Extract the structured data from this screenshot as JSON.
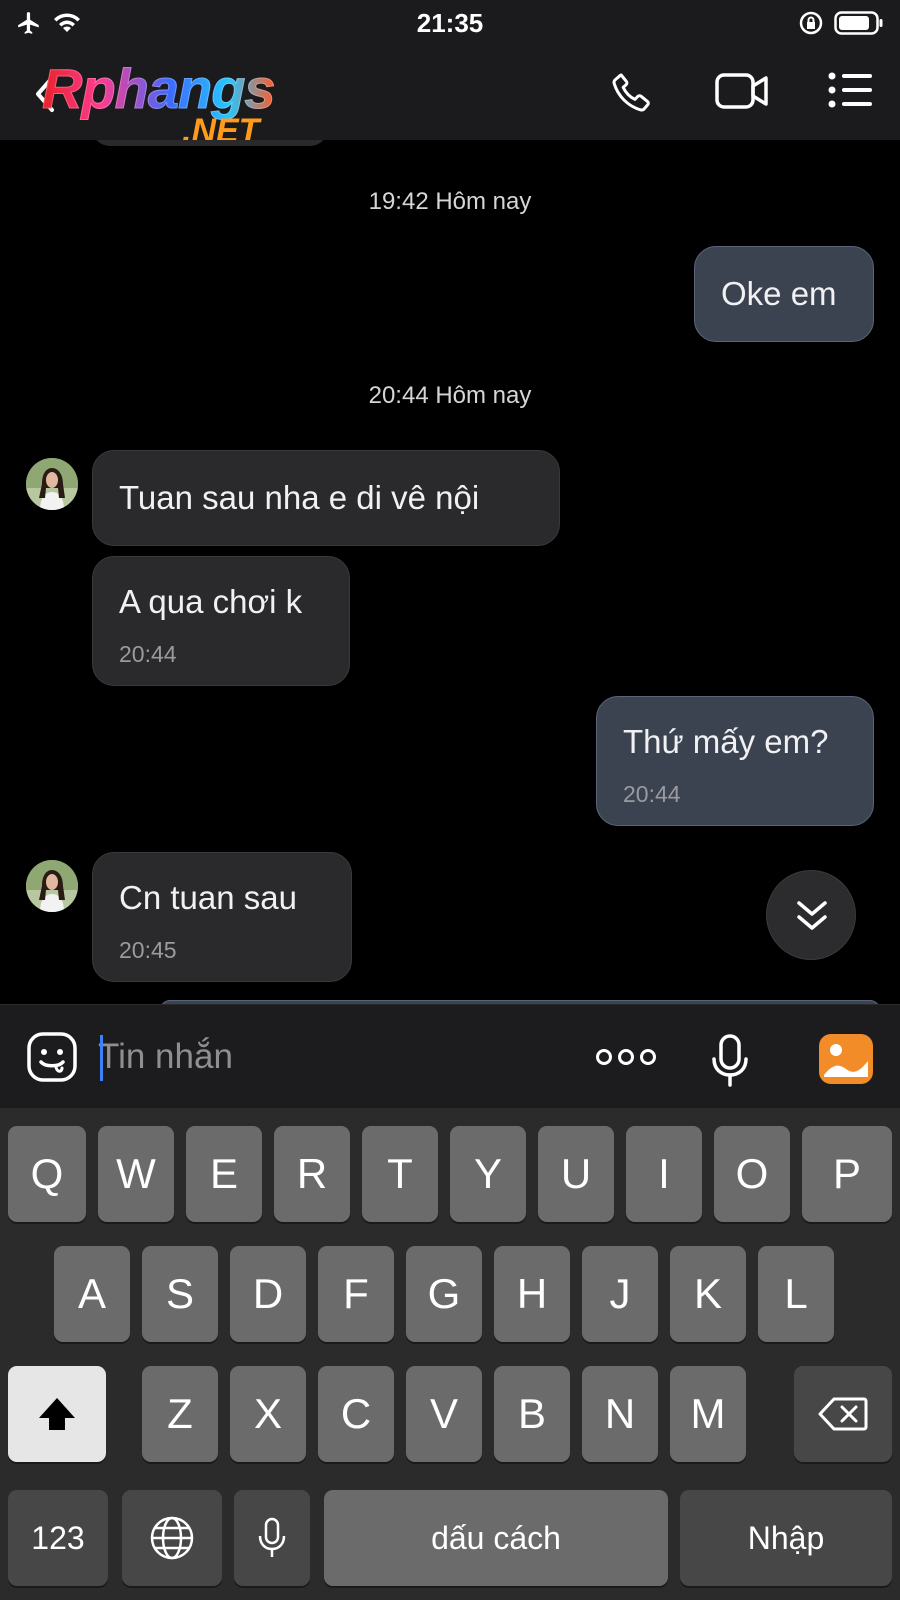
{
  "status_bar": {
    "time": "21:35"
  },
  "header": {
    "logo_text": "Rphangs",
    "logo_suffix": ".NET",
    "icons": [
      "back-icon",
      "phone-icon",
      "video-call-icon",
      "menu-list-icon"
    ]
  },
  "chat": {
    "timestamps": [
      "19:42 Hôm nay",
      "20:44 Hôm nay"
    ],
    "messages": [
      {
        "direction": "outgoing",
        "text": "Oke em",
        "time": ""
      },
      {
        "direction": "incoming",
        "text": " Tuan sau nha e di vê  nội",
        "time": ""
      },
      {
        "direction": "incoming",
        "text": "A qua chơi k",
        "time": "20:44"
      },
      {
        "direction": "outgoing",
        "text": "Thứ mấy em?",
        "time": "20:44"
      },
      {
        "direction": "incoming",
        "text": " Cn tuan sau",
        "time": "20:45"
      }
    ]
  },
  "input_bar": {
    "placeholder": "Tin nhắn",
    "value": ""
  },
  "keyboard": {
    "row1": [
      "Q",
      "W",
      "E",
      "R",
      "T",
      "Y",
      "U",
      "I",
      "O",
      "P"
    ],
    "row2": [
      "A",
      "S",
      "D",
      "F",
      "G",
      "H",
      "J",
      "K",
      "L"
    ],
    "row3": [
      "Z",
      "X",
      "C",
      "V",
      "B",
      "N",
      "M"
    ],
    "numbers_label": "123",
    "space_label": "dấu cách",
    "return_label": "Nhập"
  },
  "colors": {
    "background": "#000000",
    "header": "#1b1b1d",
    "incoming_bubble": "#2a2a2c",
    "outgoing_bubble": "#3b4350",
    "keyboard": "#2b2b2b",
    "key": "#6b6b6b",
    "accent_caret": "#3b82f6",
    "image_button": "#f28c28"
  }
}
